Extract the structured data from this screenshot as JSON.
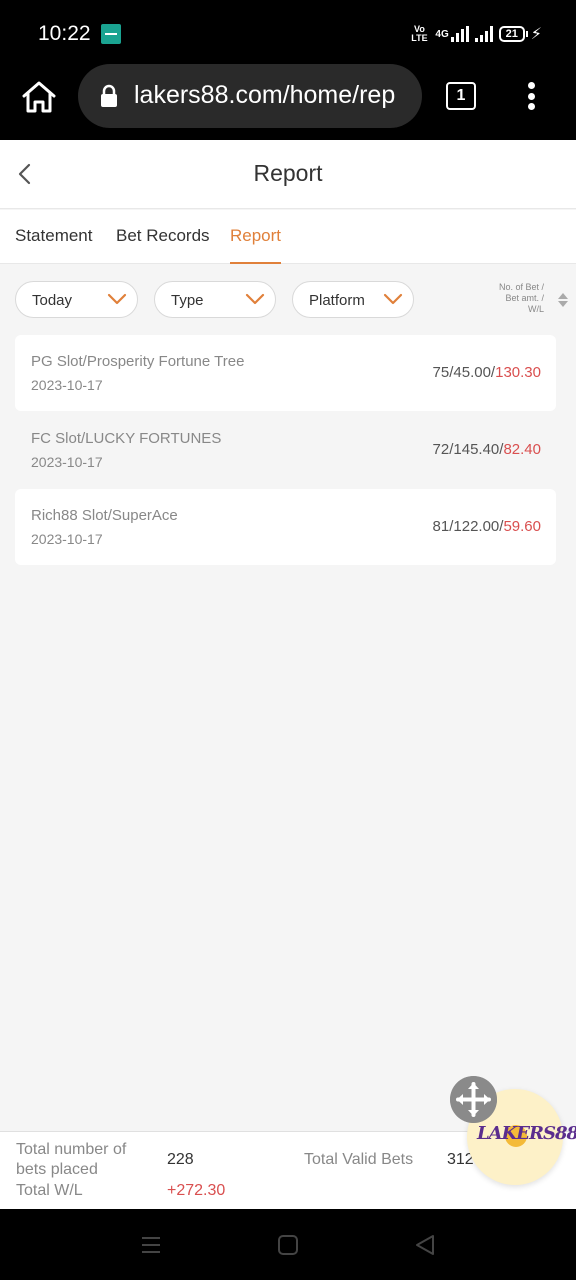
{
  "status_bar": {
    "time": "10:22",
    "volte": "VoLTE",
    "network": "4G",
    "battery": "21"
  },
  "browser": {
    "url": "lakers88.com/home/rep",
    "tab_count": "1"
  },
  "header": {
    "title": "Report"
  },
  "tabs": [
    {
      "label": "Statement",
      "active": false
    },
    {
      "label": "Bet Records",
      "active": false
    },
    {
      "label": "Report",
      "active": true
    }
  ],
  "filters": {
    "date": "Today",
    "type": "Type",
    "platform": "Platform",
    "sort_label_1": "No. of Bet /",
    "sort_label_2": "Bet amt. /",
    "sort_label_3": "W/L"
  },
  "records": [
    {
      "name": "PG Slot/Prosperity Fortune Tree",
      "date": "2023-10-17",
      "bets": "75/45.00/",
      "wl": "130.30"
    },
    {
      "name": "FC Slot/LUCKY FORTUNES",
      "date": "2023-10-17",
      "bets": "72/145.40/",
      "wl": "82.40"
    },
    {
      "name": "Rich88 Slot/SuperAce",
      "date": "2023-10-17",
      "bets": "81/122.00/",
      "wl": "59.60"
    }
  ],
  "summary": {
    "total_bets_label": "Total number of bets placed",
    "total_bets_value": "228",
    "total_wl_label": "Total W/L",
    "total_wl_value": "+272.30",
    "total_valid_label": "Total Valid Bets",
    "total_valid_value": "312"
  },
  "floating_logo": "LAKERS88",
  "colors": {
    "accent": "#e0803a",
    "negative": "#d94f4f",
    "background": "#f5f5f5"
  }
}
